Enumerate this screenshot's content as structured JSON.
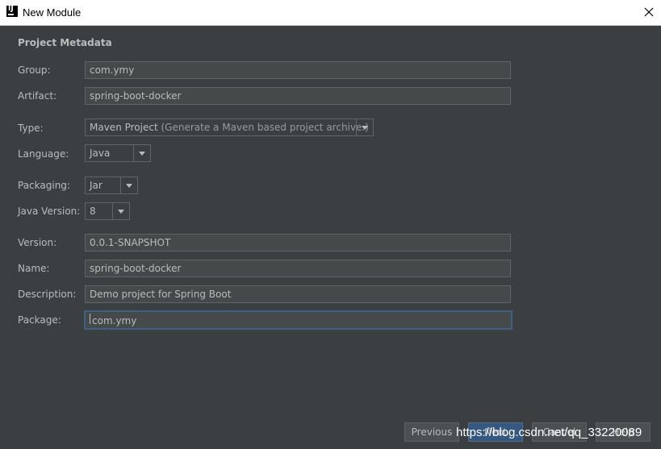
{
  "window": {
    "title": "New Module"
  },
  "section": "Project Metadata",
  "fields": {
    "group": {
      "label": "Group:",
      "value": "com.ymy"
    },
    "artifact": {
      "label": "Artifact:",
      "value": "spring-boot-docker"
    },
    "type": {
      "label": "Type:",
      "value": "Maven Project",
      "hint": "(Generate a Maven based project archive.)"
    },
    "language": {
      "label": "Language:",
      "value": "Java"
    },
    "packaging": {
      "label": "Packaging:",
      "value": "Jar"
    },
    "java_version": {
      "label": "Java Version:",
      "value": "8"
    },
    "version": {
      "label": "Version:",
      "value": "0.0.1-SNAPSHOT"
    },
    "name": {
      "label": "Name:",
      "value": "spring-boot-docker"
    },
    "description": {
      "label": "Description:",
      "value": "Demo project for Spring Boot"
    },
    "package": {
      "label": "Package:",
      "value": "com.ymy"
    }
  },
  "buttons": {
    "previous": "Previous",
    "next": "Next",
    "cancel": "Cancel",
    "help": "Help"
  },
  "watermark": "https://blog.csdn.net/qq_33220089",
  "icons": {
    "app": "intellij-icon",
    "close": "close-icon",
    "dropdown": "chevron-down-icon"
  },
  "colors": {
    "background": "#3c3f41",
    "field_bg": "#45494a",
    "focus_border": "#3d6185",
    "primary_button": "#365880"
  }
}
